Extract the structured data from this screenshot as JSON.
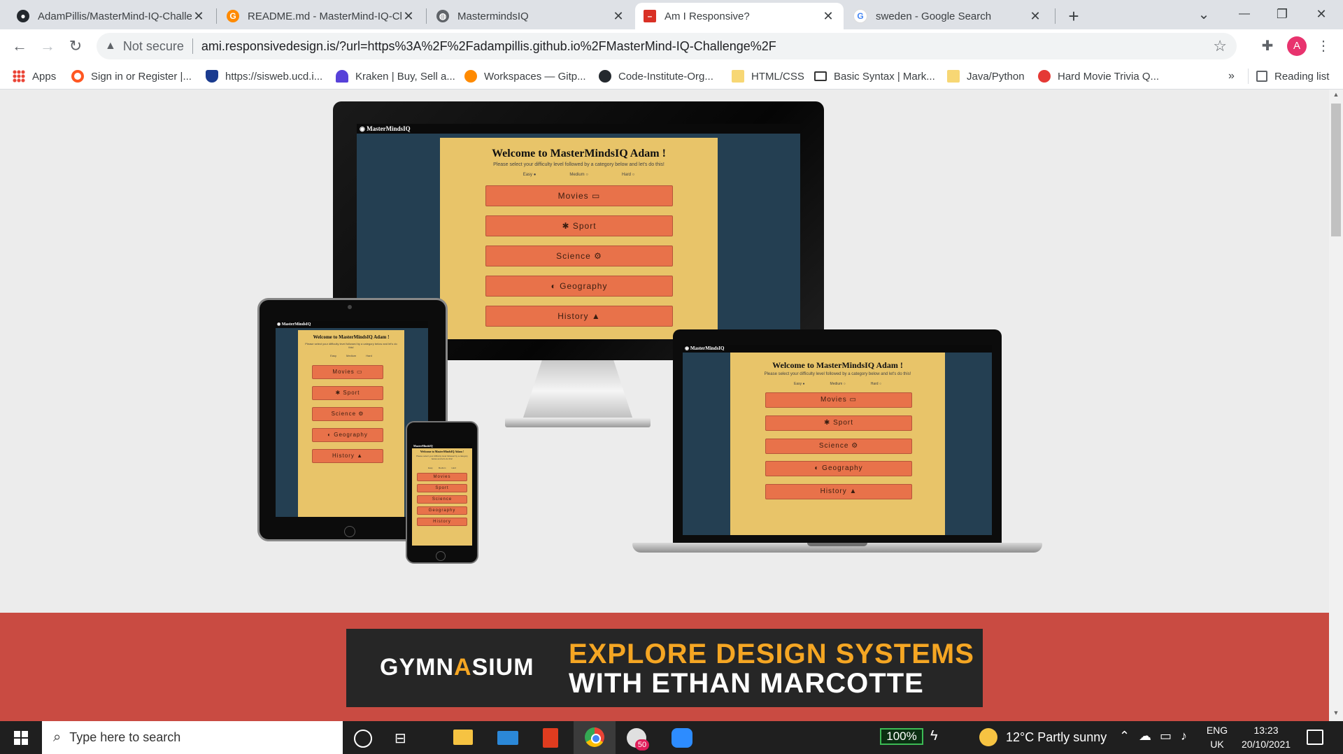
{
  "tabs": [
    {
      "title": "AdamPillis/MasterMind-IQ-Challe",
      "icon": "github-icon",
      "close": "✕"
    },
    {
      "title": "README.md - MasterMind-IQ-Ch",
      "icon": "gitpod-icon",
      "close": "✕"
    },
    {
      "title": "MastermindsIQ",
      "icon": "globe-icon",
      "close": "✕"
    },
    {
      "title": "Am I Responsive?",
      "icon": "ami-icon",
      "close": "✕",
      "active": true
    },
    {
      "title": "sweden - Google Search",
      "icon": "google-icon",
      "close": "✕"
    }
  ],
  "new_tab": "+",
  "window_controls": {
    "dropdown": "⌄",
    "minimize": "—",
    "restore": "❐",
    "close": "✕"
  },
  "address": {
    "security": "Not secure",
    "url": "ami.responsivedesign.is/?url=https%3A%2F%2Fadampillis.github.io%2FMasterMind-IQ-Challenge%2F"
  },
  "profile_initial": "A",
  "bookmarks": [
    {
      "label": "Apps",
      "icon": "apps-grid-icon"
    },
    {
      "label": "Sign in or Register |...",
      "icon": "ring-icon"
    },
    {
      "label": "https://sisweb.ucd.i...",
      "icon": "shield-crest-icon"
    },
    {
      "label": "Kraken | Buy, Sell a...",
      "icon": "kraken-icon"
    },
    {
      "label": "Workspaces — Gitp...",
      "icon": "gitpod-icon"
    },
    {
      "label": "Code-Institute-Org...",
      "icon": "github-icon"
    },
    {
      "label": "HTML/CSS",
      "icon": "folder-icon"
    },
    {
      "label": "Basic Syntax | Mark...",
      "icon": "markdown-icon"
    },
    {
      "label": "Java/Python",
      "icon": "folder-icon"
    },
    {
      "label": "Hard Movie Trivia Q...",
      "icon": "trivia-icon"
    }
  ],
  "bookmarks_more": "»",
  "reading_list": "Reading list",
  "app_preview": {
    "brand": "MasterMindsIQ",
    "welcome": "Welcome to MasterMindsIQ Adam !",
    "instructions": "Please select your difficulty level followed by a category below and let's do this!",
    "difficulties": [
      "Easy",
      "Medium",
      "Hard"
    ],
    "categories": [
      {
        "label": "Movies",
        "icon": "▭"
      },
      {
        "label": "Sport",
        "icon": "✱",
        "icon_first": true
      },
      {
        "label": "Science",
        "icon": "⚙"
      },
      {
        "label": "Geography",
        "icon": "◐",
        "icon_first": true
      },
      {
        "label": "History",
        "icon": "▲"
      }
    ]
  },
  "ad": {
    "brand_left": "GYMN",
    "brand_accent": "A",
    "brand_right": "SIUM",
    "headline_line1": "EXPLORE DESIGN SYSTEMS",
    "headline_line2": "WITH ETHAN MARCOTTE"
  },
  "taskbar": {
    "search_placeholder": "Type here to search",
    "battery": "100%",
    "weather": "12°C  Partly sunny",
    "language_line1": "ENG",
    "language_line2": "UK",
    "time": "13:23",
    "date": "20/10/2021",
    "badge": "50"
  },
  "colors": {
    "tab_bg": "#dee1e6",
    "page_bg": "#ececec",
    "app_panel": "#e8c469",
    "app_side": "#243f52",
    "app_button": "#e8724a",
    "ad_band": "#c94b42",
    "ad_accent": "#f5a623"
  }
}
